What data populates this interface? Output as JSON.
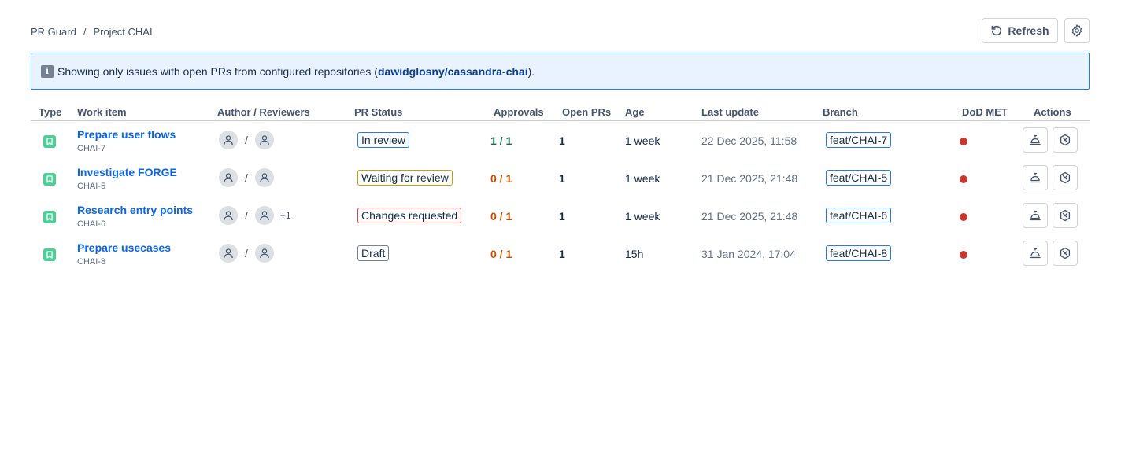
{
  "breadcrumb": {
    "root": "PR Guard",
    "separator": "/",
    "current": "Project CHAI"
  },
  "toolbar": {
    "refresh_label": "Refresh",
    "refresh_icon": "refresh-icon",
    "settings_icon": "gear-icon"
  },
  "banner": {
    "icon": "info-icon",
    "icon_glyph": "i",
    "text_before": "Showing only issues with open PRs from configured repositories (",
    "repo": "dawidglosny/cassandra-chai",
    "text_after": ")."
  },
  "table": {
    "headers": {
      "type": "Type",
      "work_item": "Work item",
      "author_reviewers": "Author / Reviewers",
      "pr_status": "PR Status",
      "approvals": "Approvals",
      "open_prs": "Open PRs",
      "age": "Age",
      "last_update": "Last update",
      "branch": "Branch",
      "dod_met": "DoD MET",
      "actions": "Actions"
    },
    "rows": [
      {
        "title": "Prepare user flows",
        "key": "CHAI-7",
        "slash": "/",
        "extra_reviewers": "",
        "status": "In review",
        "approvals": "1 / 1",
        "open_prs": "1",
        "age": "1 week",
        "last_update": "22 Dec 2025, 11:58",
        "branch": "feat/CHAI-7"
      },
      {
        "title": "Investigate FORGE",
        "key": "CHAI-5",
        "slash": "/",
        "extra_reviewers": "",
        "status": "Waiting for review",
        "approvals": "0 / 1",
        "open_prs": "1",
        "age": "1 week",
        "last_update": "21 Dec 2025, 21:48",
        "branch": "feat/CHAI-5"
      },
      {
        "title": "Research entry points",
        "key": "CHAI-6",
        "slash": "/",
        "extra_reviewers": "+1",
        "status": "Changes requested",
        "approvals": "0 / 1",
        "open_prs": "1",
        "age": "1 week",
        "last_update": "21 Dec 2025, 21:48",
        "branch": "feat/CHAI-6"
      },
      {
        "title": "Prepare usecases",
        "key": "CHAI-8",
        "slash": "/",
        "extra_reviewers": "",
        "status": "Draft",
        "approvals": "0 / 1",
        "open_prs": "1",
        "age": "15h",
        "last_update": "31 Jan 2024, 17:04",
        "branch": "feat/CHAI-8"
      }
    ]
  },
  "colors": {
    "link": "#0c66e4",
    "banner_bg": "#e9f2ff",
    "banner_border": "#1d7afc",
    "type_icon": "#4bce97",
    "approved": "#216e4e",
    "pending": "#c25100",
    "dod_not_met": "#c9372c"
  }
}
